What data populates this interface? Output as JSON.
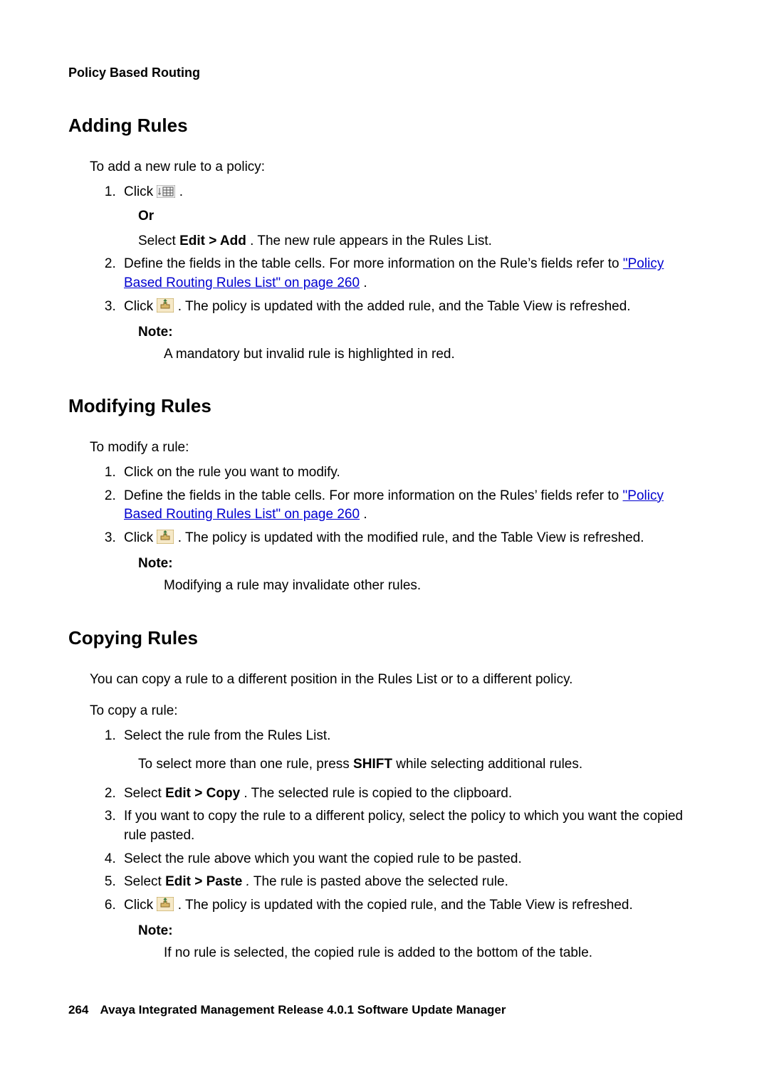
{
  "running_head": "Policy Based Routing",
  "sections": {
    "adding": {
      "title": "Adding Rules",
      "intro": "To add a new rule to a policy:",
      "step1_a": "Click ",
      "step1_b": " .",
      "or": "Or",
      "step1_alt_a": "Select ",
      "step1_alt_bold": "Edit > Add",
      "step1_alt_b": ". The new rule appears in the Rules List.",
      "step2_a": "Define the fields in the table cells. For more information on the Rule’s fields refer to ",
      "step2_link": "\"Policy Based Routing Rules List\" on page 260",
      "step2_b": ".",
      "step3_a": "Click ",
      "step3_b": " . The policy is updated with the added rule, and the Table View is refreshed.",
      "note_label": "Note:",
      "note_body": "A mandatory but invalid rule is highlighted in red."
    },
    "modifying": {
      "title": "Modifying Rules",
      "intro": "To modify a rule:",
      "step1": "Click on the rule you want to modify.",
      "step2_a": "Define the fields in the table cells. For more information on the Rules’ fields refer to ",
      "step2_link": "\"Policy Based Routing Rules List\" on page 260",
      "step2_b": ".",
      "step3_a": "Click ",
      "step3_b": " . The policy is updated with the modified rule, and the Table View is refreshed.",
      "note_label": "Note:",
      "note_body": "Modifying a rule may invalidate other rules."
    },
    "copying": {
      "title": "Copying Rules",
      "intro1": "You can copy a rule to a different position in the Rules List or to a different policy.",
      "intro2": "To copy a rule:",
      "step1": "Select the rule from the Rules List.",
      "step1_sub_a": "To select more than one rule, press ",
      "step1_sub_bold": "SHIFT",
      "step1_sub_b": " while selecting additional rules.",
      "step2_a": "Select ",
      "step2_bold": "Edit > Copy",
      "step2_b": ". The selected rule is copied to the clipboard.",
      "step3": "If you want to copy the rule to a different policy, select the policy to which you want the copied rule pasted.",
      "step4": "Select the rule above which you want the copied rule to be pasted.",
      "step5_a": "Select ",
      "step5_bold": "Edit > Paste",
      "step5_dot": ".",
      "step5_b": " The rule is pasted above the selected rule.",
      "step6_a": "Click ",
      "step6_b": " . The policy is updated with the copied rule, and the Table View is refreshed.",
      "note_label": "Note:",
      "note_body": "If no rule is selected, the copied rule is added to the bottom of the table."
    }
  },
  "footer": {
    "page": "264",
    "title": "Avaya Integrated Management Release 4.0.1 Software Update Manager"
  }
}
